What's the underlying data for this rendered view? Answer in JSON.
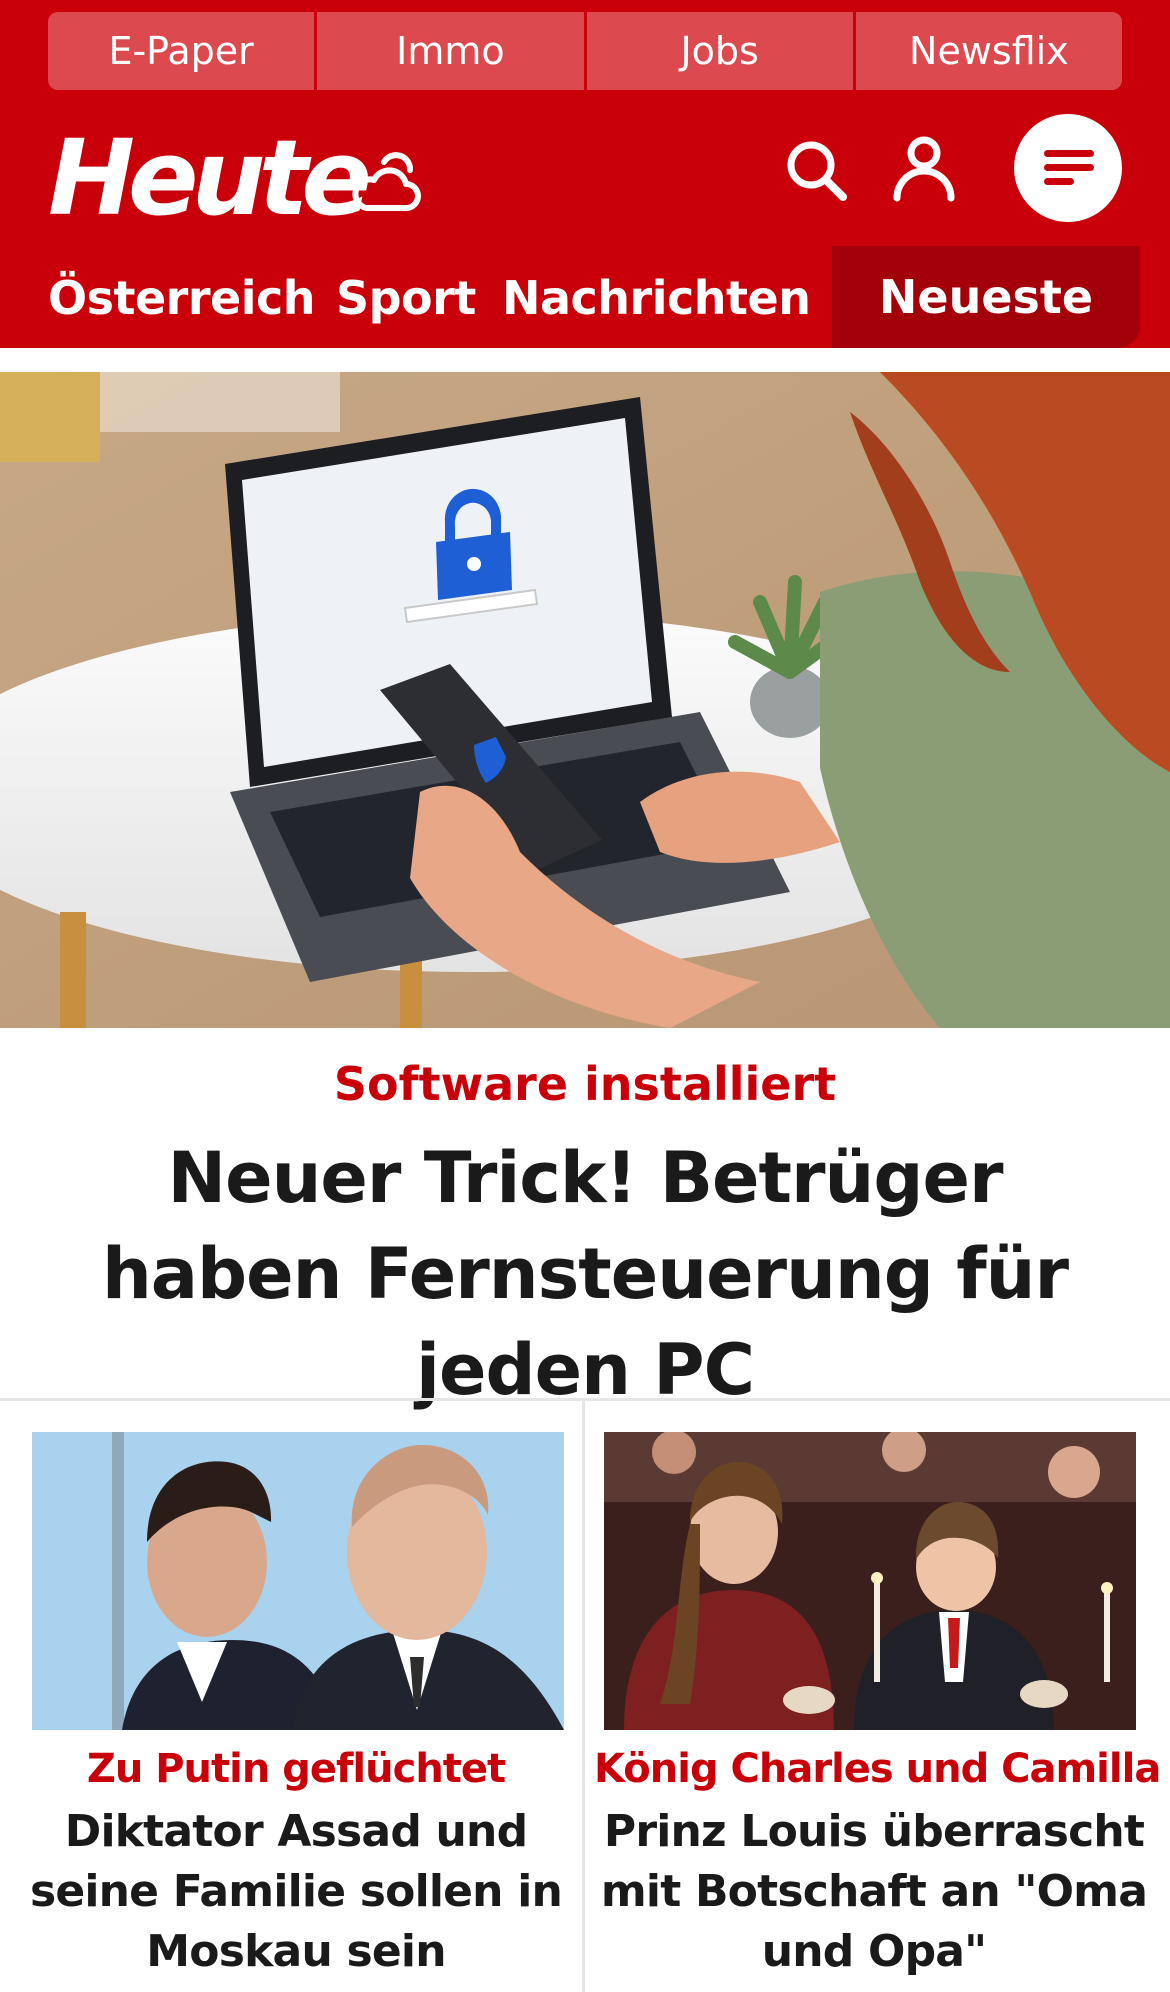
{
  "service_bar": {
    "items": [
      {
        "label": "E-Paper"
      },
      {
        "label": "Immo"
      },
      {
        "label": "Jobs"
      },
      {
        "label": "Newsflix"
      }
    ]
  },
  "header": {
    "logo_text": "Heute",
    "weather_icon": "cloud-sun-icon",
    "search_icon": "search-icon",
    "user_icon": "user-icon",
    "menu_icon": "menu-icon"
  },
  "nav": {
    "items": [
      {
        "label": "Österreich"
      },
      {
        "label": "Sport"
      },
      {
        "label": "Nachrichten"
      }
    ],
    "active": {
      "label": "Neueste"
    }
  },
  "hero": {
    "kicker": "Software installiert",
    "title": "Neuer Trick! Betrüger haben Fernsteuerung für jeden PC"
  },
  "cards": [
    {
      "kicker": "Zu Putin geflüchtet",
      "title": "Diktator Assad und seine Familie sollen in Moskau sein"
    },
    {
      "kicker": "König Charles und Camilla",
      "title": "Prinz Louis überrascht mit Botschaft an \"Oma und Opa\""
    }
  ],
  "colors": {
    "brand_red": "#c9000a",
    "service_bar_bg": "#dc4a4f",
    "nav_active_bg": "#a3000a",
    "headline_text": "#1a1a1a"
  }
}
